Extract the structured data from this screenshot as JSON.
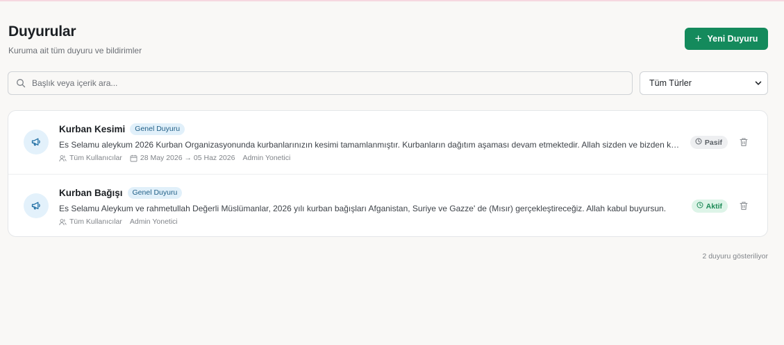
{
  "header": {
    "title": "Duyurular",
    "subtitle": "Kuruma ait tüm duyuru ve bildirimler",
    "new_button_label": "Yeni Duyuru",
    "new_button_icon": "plus-icon"
  },
  "filters": {
    "search_placeholder": "Başlık veya içerik ara...",
    "search_value": "",
    "type_select_value": "Tüm Türler"
  },
  "colors": {
    "primary": "#148a5c",
    "tag_bg": "#e1f0fa",
    "active_status": "#1d8a57",
    "passive_status": "#5b6066"
  },
  "announcements": [
    {
      "title": "Kurban Kesimi",
      "tag": "Genel Duyuru",
      "content": "Es Selamu aleykum 2026 Kurban Organizasyonunda kurbanlarınızın kesimi tamamlanmıştır. Kurbanların dağıtım aşaması devam etmektedir. Allah sizden ve bizden kabul etsin.",
      "audience": "Tüm Kullanıcılar",
      "date_range": "28 May 2026 → 05 Haz 2026",
      "author": "Admin Yonetici",
      "status": "Pasif",
      "icon": "megaphone-icon"
    },
    {
      "title": "Kurban Bağışı",
      "tag": "Genel Duyuru",
      "content": "Es Selamu Aleykum ve rahmetullah Değerli Müslümanlar, 2026 yılı kurban bağışları Afganistan, Suriye ve Gazze' de (Mısır) gerçekleştireceğiz. Allah kabul buyursun.",
      "audience": "Tüm Kullanıcılar",
      "author": "Admin Yonetici",
      "status": "Aktif",
      "icon": "megaphone-icon"
    }
  ],
  "footer": {
    "count_text": "2 duyuru gösteriliyor"
  }
}
